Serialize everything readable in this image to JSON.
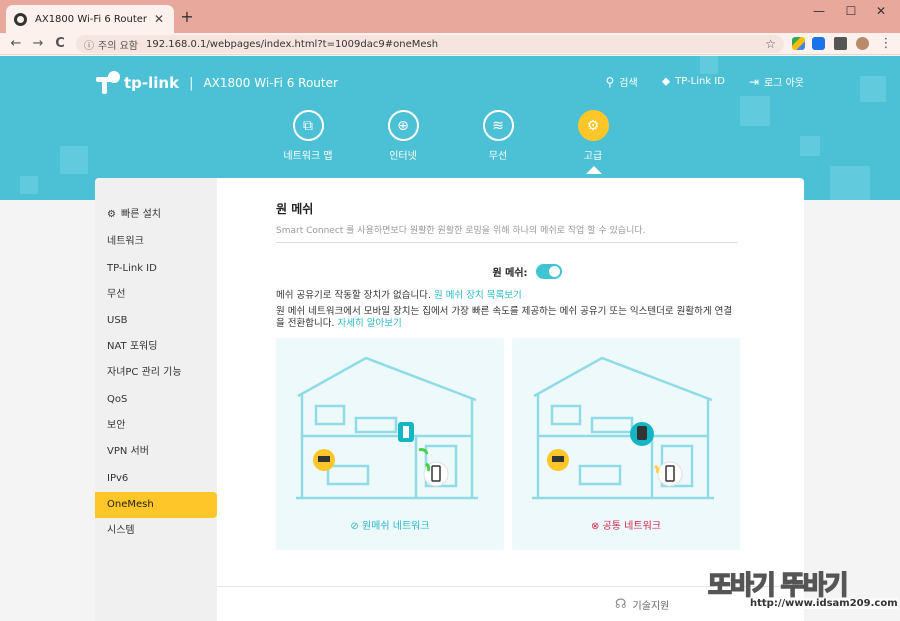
{
  "browser": {
    "tab_title": "AX1800 Wi-Fi 6 Router",
    "tab_close": "✕",
    "new_tab": "+",
    "minimize": "—",
    "maximize": "☐",
    "close": "✕",
    "back": "←",
    "forward": "→",
    "reload": "C",
    "security_icon": "ⓘ",
    "security_label": "주의 요함",
    "url": "192.168.0.1/webpages/index.html?t=1009dac9#oneMesh",
    "bookmark": "☆"
  },
  "header": {
    "brand": "tp-link",
    "separator": "|",
    "model": "AX1800 Wi-Fi 6 Router",
    "links": [
      {
        "icon": "search-icon",
        "glyph": "⚲",
        "label": "검색"
      },
      {
        "icon": "tplink-id-icon",
        "glyph": "⬥",
        "label": "TP-Link ID"
      },
      {
        "icon": "logout-icon",
        "glyph": "⇥",
        "label": "로그 아웃"
      }
    ]
  },
  "nav": [
    {
      "label": "네트워크 맵",
      "glyph": "⧉",
      "active": false
    },
    {
      "label": "인터넷",
      "glyph": "⊕",
      "active": false
    },
    {
      "label": "무선",
      "glyph": "≋",
      "active": false
    },
    {
      "label": "고급",
      "glyph": "⚙",
      "active": true
    }
  ],
  "sidebar": {
    "items": [
      {
        "label": "빠른 설치",
        "gear": "⚙"
      },
      {
        "label": "네트워크"
      },
      {
        "label": "TP-Link ID"
      },
      {
        "label": "무선"
      },
      {
        "label": "USB"
      },
      {
        "label": "NAT 포워딩"
      },
      {
        "label": "자녀PC 관리 기능"
      },
      {
        "label": "QoS"
      },
      {
        "label": "보안"
      },
      {
        "label": "VPN 서버"
      },
      {
        "label": "IPv6"
      },
      {
        "label": "OneMesh"
      },
      {
        "label": "시스템"
      }
    ],
    "active_index": 11
  },
  "content": {
    "title": "원 메쉬",
    "description": "Smart Connect 를 사용하면보다 원활한 원활한 로밍을 위해 하나의 메쉬로 작업 할 수 있습니다.",
    "toggle_label": "원 메쉬:",
    "toggle_on": true,
    "no_devices_text": "메쉬 공유기로 작동할 장치가 없습니다. ",
    "device_list_link": "원 메쉬 장치 목록보기",
    "info_text": "원 메쉬 네트워크에서 모바일 장치는 집에서 가장 빠른 속도를 제공하는 메쉬 공유기 또는 익스텐더로 원활하게 연결을 전환합니다. ",
    "learn_more_link": "자세히 알아보기",
    "panels": [
      {
        "caption": "원메쉬 네트워크",
        "caption_icon": "⊘",
        "kind": "ok"
      },
      {
        "caption": "공통 네트워크",
        "caption_icon": "⊗",
        "kind": "bad"
      }
    ]
  },
  "footer": {
    "support_icon": "headset-icon",
    "support_glyph": "☊",
    "support_label": "기술지원"
  },
  "watermark": {
    "text": "또바기 뚜바기",
    "url": "http://www.idsam209.com"
  },
  "colors": {
    "accent": "#4cc1d6",
    "active": "#ffc629",
    "link": "#2ab7c8",
    "error": "#d0284b"
  }
}
